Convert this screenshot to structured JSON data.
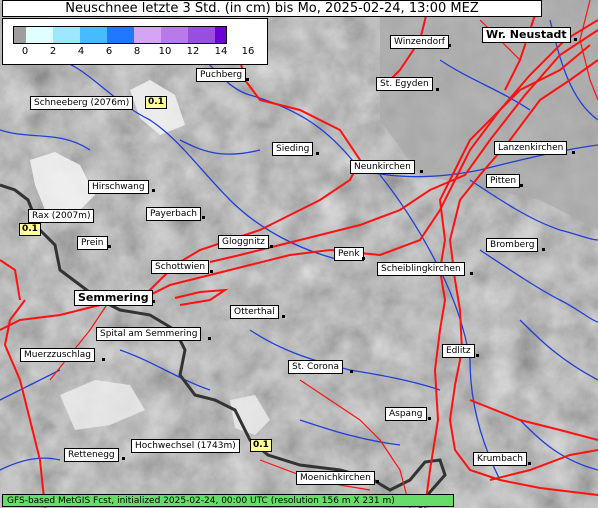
{
  "title": "Neuschnee letzte 3 Std. (in cm) bis Mo, 2025-02-24, 13:00 MEZ",
  "legend": {
    "ticks": [
      "0",
      "2",
      "4",
      "6",
      "8",
      "10",
      "12",
      "14",
      "16"
    ],
    "colors": [
      "#9e9e9e",
      "#e0ffff",
      "#9ee8ff",
      "#46bcff",
      "#1f78ff",
      "#d6a4f5",
      "#b77ae8",
      "#9a4ee0",
      "#6d00d6"
    ]
  },
  "places": [
    {
      "name": "Winzendorf"
    },
    {
      "name": "Wr. Neustadt"
    },
    {
      "name": "Puchberg"
    },
    {
      "name": "St. Egyden"
    },
    {
      "name": "Schneeberg (2076m)"
    },
    {
      "name": "Sieding"
    },
    {
      "name": "Neunkirchen"
    },
    {
      "name": "Lanzenkirchen"
    },
    {
      "name": "Hirschwang"
    },
    {
      "name": "Pitten"
    },
    {
      "name": "Rax (2007m)"
    },
    {
      "name": "Payerbach"
    },
    {
      "name": "Prein"
    },
    {
      "name": "Gloggnitz"
    },
    {
      "name": "Bromberg"
    },
    {
      "name": "Penk"
    },
    {
      "name": "Schottwien"
    },
    {
      "name": "Scheiblingkirchen"
    },
    {
      "name": "Semmering"
    },
    {
      "name": "Otterthal"
    },
    {
      "name": "Spital am Semmering"
    },
    {
      "name": "Muerzzuschlag"
    },
    {
      "name": "Edlitz"
    },
    {
      "name": "St. Corona"
    },
    {
      "name": "Aspang"
    },
    {
      "name": "Rettenegg"
    },
    {
      "name": "Hochwechsel (1743m)"
    },
    {
      "name": "Krumbach"
    },
    {
      "name": "Moenichkirchen"
    }
  ],
  "values": [
    "0.1",
    "0.1",
    "0.1"
  ],
  "footer": "GFS-based MetGIS Fcst, initialized 2025-02-24, 00:00 UTC  (resolution 156 m X 231 m)"
}
